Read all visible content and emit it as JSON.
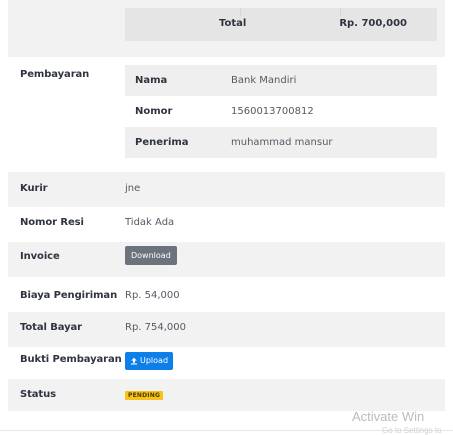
{
  "order_total": {
    "label": "Total",
    "value": "Rp. 700,000"
  },
  "payment": {
    "label": "Pembayaran",
    "rows": [
      {
        "key": "Nama",
        "value": "Bank Mandiri"
      },
      {
        "key": "Nomor",
        "value": "1560013700812"
      },
      {
        "key": "Penerima",
        "value": "muhammad mansur"
      }
    ]
  },
  "details": {
    "courier": {
      "label": "Kurir",
      "value": "jne"
    },
    "tracking": {
      "label": "Nomor Resi",
      "value": "Tidak Ada"
    },
    "invoice": {
      "label": "Invoice",
      "button": "Download"
    },
    "shipping_cost": {
      "label": "Biaya Pengiriman",
      "value": "Rp. 54,000"
    },
    "total_pay": {
      "label": "Total Bayar",
      "value": "Rp. 754,000"
    },
    "proof": {
      "label": "Bukti Pembayaran",
      "button": "Upload",
      "icon": "upload-icon"
    },
    "status": {
      "label": "Status",
      "badge": "PENDING",
      "badge_color": "#f7c31a"
    }
  },
  "colors": {
    "stripe": "#f2f2f2",
    "upload_button": "#0d7fe8",
    "download_button": "#6c737c"
  },
  "watermark": {
    "title": "Activate Win",
    "subtitle": "Go to Settings to"
  }
}
